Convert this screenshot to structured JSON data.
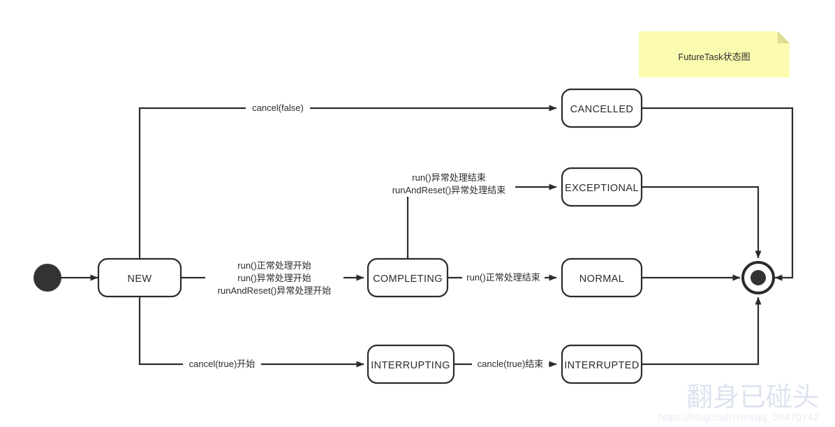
{
  "diagram": {
    "title_note": "FutureTask状态图",
    "states": {
      "new": "NEW",
      "completing": "COMPLETING",
      "cancelled": "CANCELLED",
      "exceptional": "EXCEPTIONAL",
      "normal": "NORMAL",
      "interrupting": "INTERRUPTING",
      "interrupted": "INTERRUPTED"
    },
    "edges": {
      "cancel_false": "cancel(false)",
      "new_to_completing_1": "run()正常处理开始",
      "new_to_completing_2": "run()异常处理开始",
      "new_to_completing_3": "runAndReset()异常处理开始",
      "completing_to_exceptional_1": "run()异常处理结束",
      "completing_to_exceptional_2": "runAndReset()异常处理结束",
      "completing_to_normal": "run()正常处理结束",
      "cancel_true_start": "cancel(true)开始",
      "cancle_true_end": "cancle(true)结束"
    },
    "watermark": {
      "text": "翻身已碰头",
      "url": "https://blog.csdn.net/qq_39470742"
    },
    "colors": {
      "stroke": "#2b2b2b",
      "note_bg": "#fbfbb0",
      "note_fold": "#dedc8e",
      "node": "#333333"
    }
  }
}
